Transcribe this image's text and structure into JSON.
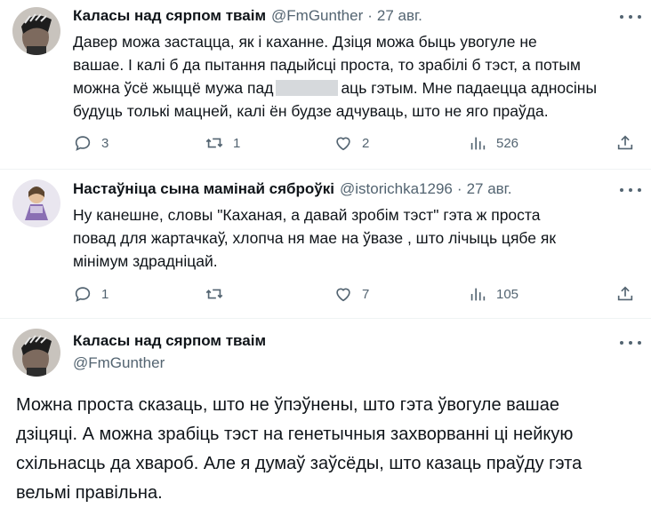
{
  "tweet1": {
    "name": "Каласы над сярпом тваім",
    "handle": "@FmGunther",
    "date": "27 авг.",
    "line1": "Давер можа застацца, як і каханне. Дзіця можа быць увогуле не",
    "line2": "вашае. І калі б  да пытання падыйсці проста, то зрабілі б тэст, а потым",
    "line3a": "можна ўсё жыццё мужа пад",
    "line3b": "аць гэтым. Мне падаецца адносіны",
    "line4": "будуць толькі мацней, калі ён будзе адчуваць, што не яго праўда.",
    "replies": "3",
    "retweets": "1",
    "likes": "2",
    "views": "526"
  },
  "tweet2": {
    "name": "Настаўніца сына мамінай сяброўкі",
    "handle": "@istorichka1296",
    "date": "27 авг.",
    "line1": "Ну канешне,  словы \"Каханая, а давай зробім тэст\" гэта ж проста",
    "line2": "повад для жартачкаў, хлопча ня мае на ўвазе , што лічыць цябе як",
    "line3": "мінімум здрадніцай.",
    "replies": "1",
    "retweets": "",
    "likes": "7",
    "views": "105"
  },
  "tweet3": {
    "name": "Каласы над сярпом тваім",
    "handle": "@FmGunther",
    "line1": "Можна проста сказаць, што не ўпэўнены, што гэта ўвогуле вашае",
    "line2": "дзіцяці. А можна зрабіць тэст на генетычныя захворванні ці нейкую",
    "line3": "схільнасць да хвароб. Але я думаў заўсёды, што казаць праўду гэта",
    "line4": "вельмі правільна."
  },
  "colors": {
    "text": "#0f1419",
    "secondary": "#536471",
    "divider": "#eff3f4"
  },
  "icons": [
    "reply-icon",
    "retweet-icon",
    "like-icon",
    "views-icon",
    "share-icon",
    "more-icon"
  ]
}
